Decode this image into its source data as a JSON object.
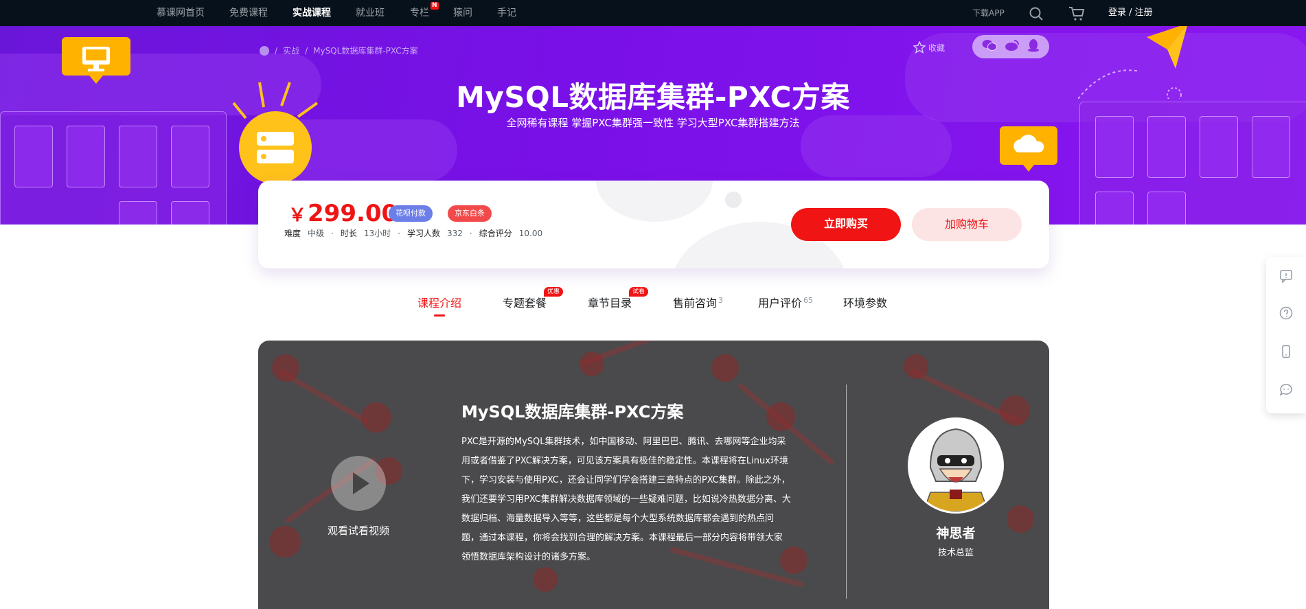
{
  "nav": {
    "items": [
      {
        "label": "慕课网首页",
        "active": false
      },
      {
        "label": "免费课程",
        "active": false
      },
      {
        "label": "实战课程",
        "active": true
      },
      {
        "label": "就业班",
        "active": false
      },
      {
        "label": "专栏",
        "active": false,
        "badge": "N"
      },
      {
        "label": "猿问",
        "active": false
      },
      {
        "label": "手记",
        "active": false
      }
    ],
    "download_app": "下载APP",
    "login": "登录 / 注册",
    "icons": [
      "search-icon",
      "cart-icon"
    ]
  },
  "hero": {
    "breadcrumb": [
      "实战",
      "MySQL数据库集群-PXC方案"
    ],
    "breadcrumb_sep": "/",
    "title": "MySQL数据库集群-PXC方案",
    "subtitle": "全网稀有课程 掌握PXC集群强一致性 学习大型PXC集群搭建方法",
    "collect_label": "收藏",
    "share_icons": [
      "wechat-icon",
      "weibo-icon",
      "qq-icon"
    ]
  },
  "price_card": {
    "yen": "￥",
    "price": "299.00",
    "pay_badges": [
      "花呗付款",
      "京东白条"
    ],
    "meta": [
      {
        "label": "难度",
        "value": "中级"
      },
      {
        "label": "时长",
        "value": "13小时"
      },
      {
        "label": "学习人数",
        "value": "332"
      },
      {
        "label": "综合评分",
        "value": "10.00"
      }
    ],
    "meta_sep": "·",
    "buy_label": "立即购买",
    "cart_label": "加购物车"
  },
  "tabs": [
    {
      "label": "课程介绍",
      "active": true,
      "badge": "",
      "count": ""
    },
    {
      "label": "专题套餐",
      "active": false,
      "badge": "优惠",
      "count": ""
    },
    {
      "label": "章节目录",
      "active": false,
      "badge": "试看",
      "count": ""
    },
    {
      "label": "售前咨询",
      "active": false,
      "badge": "",
      "count": "3"
    },
    {
      "label": "用户评价",
      "active": false,
      "badge": "",
      "count": "65"
    },
    {
      "label": "环境参数",
      "active": false,
      "badge": "",
      "count": ""
    }
  ],
  "intro": {
    "play_label": "观看试看视频",
    "title": "MySQL数据库集群-PXC方案",
    "description": "PXC是开源的MySQL集群技术，如中国移动、阿里巴巴、腾讯、去哪网等企业均采用或者借鉴了PXC解决方案，可见该方案具有极佳的稳定性。本课程将在Linux环境下，学习安装与使用PXC，还会让同学们学会搭建三高特点的PXC集群。除此之外，我们还要学习用PXC集群解决数据库领域的一些疑难问题，比如说冷热数据分离、大数据归档、海量数据导入等等，这些都是每个大型系统数据库都会遇到的热点问题，通过本课程，你将会找到合理的解决方案。本课程最后一部分内容将带领大家领悟数据库架构设计的诸多方案。",
    "teacher_name": "神思者",
    "teacher_title": "技术总监"
  },
  "floatbar_icons": [
    "feedback-icon",
    "help-icon",
    "mobile-icon",
    "chat-icon"
  ],
  "colors": {
    "accent": "#f01414",
    "hero": "#7a10e8",
    "nav_bg": "#07111b"
  }
}
